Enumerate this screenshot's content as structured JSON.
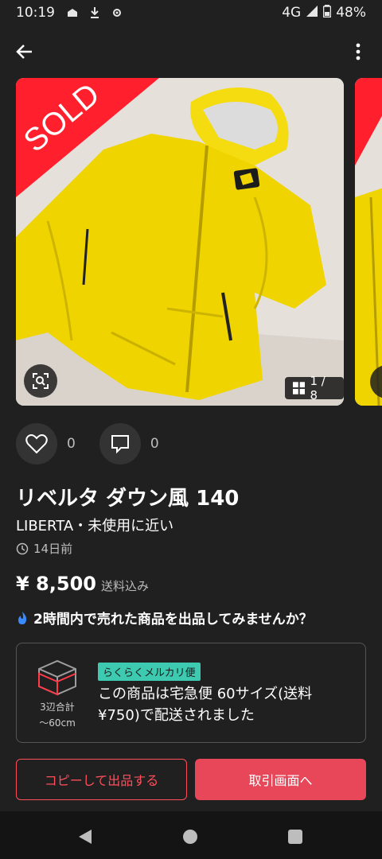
{
  "status": {
    "time": "10:19",
    "network": "4G",
    "battery": "48%"
  },
  "listing": {
    "sold_label": "SOLD",
    "photo_counter": "1 / 8",
    "likes": "0",
    "comments": "0",
    "title": "リベルタ ダウン風 140",
    "brand_condition": "LIBERTA・未使用に近い",
    "posted": "14日前",
    "price": "¥ 8,500",
    "shipping_included": "送料込み",
    "promo": "2時間内で売れた商品を出品してみませんか？"
  },
  "shipping": {
    "badge": "らくらくメルカリ便",
    "size_caption_line1": "3辺合計",
    "size_caption_line2": "〜60cm",
    "message": "この商品は宅急便 60サイズ(送料¥750)で配送されました"
  },
  "buttons": {
    "copy_listing": "コピーして出品する",
    "transaction": "取引画面へ"
  },
  "colors": {
    "accent": "#e8475a",
    "sold_ribbon": "#ff1f2d",
    "jacket": "#f0d400",
    "badge": "#3ec9b1"
  }
}
